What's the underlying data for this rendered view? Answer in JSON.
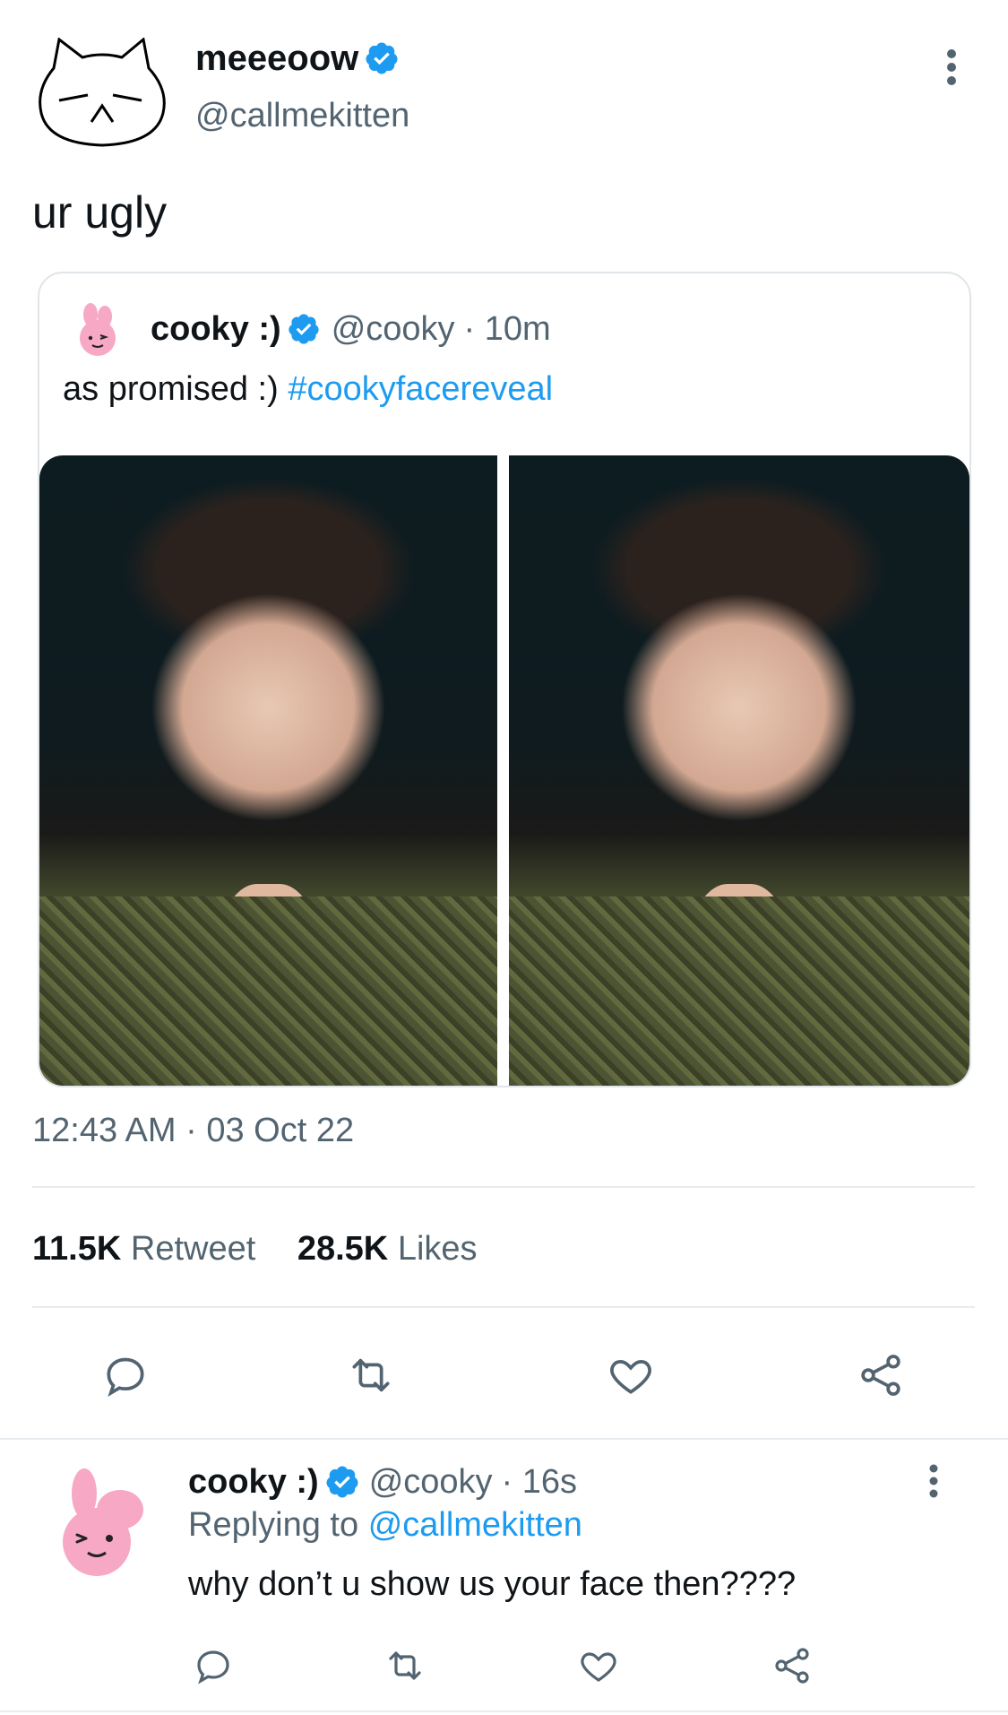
{
  "tweet": {
    "author_name": "meeeoow",
    "author_handle": "@callmekitten",
    "text": "ur ugly",
    "timestamp": "12:43 AM · 03 Oct 22",
    "retweet_count": "11.5K",
    "retweet_label": "Retweet",
    "like_count": "28.5K",
    "like_label": "Likes"
  },
  "quoted": {
    "author_name": "cooky :)",
    "author_handle": "@cooky",
    "time": "· 10m",
    "text": "as promised :)",
    "hashtag": "#cookyfacereveal",
    "images": [
      "photo-left",
      "photo-right"
    ]
  },
  "reply": {
    "author_name": "cooky :)",
    "author_handle": "@cooky",
    "time": "· 16s",
    "replying_prefix": "Replying to",
    "replying_to": "@callmekitten",
    "text": "why don’t u show us your face then????"
  },
  "icons": {
    "reply": "comment-icon",
    "retweet": "retweet-icon",
    "like": "heart-icon",
    "share": "share-icon",
    "more": "more-vertical-icon",
    "verified": "verified-badge-icon"
  },
  "colors": {
    "accent": "#1d9bf0",
    "text": "#0f1419",
    "muted": "#536471",
    "divider": "#e6ecf0",
    "cooky_pink": "#f7a8c4"
  }
}
